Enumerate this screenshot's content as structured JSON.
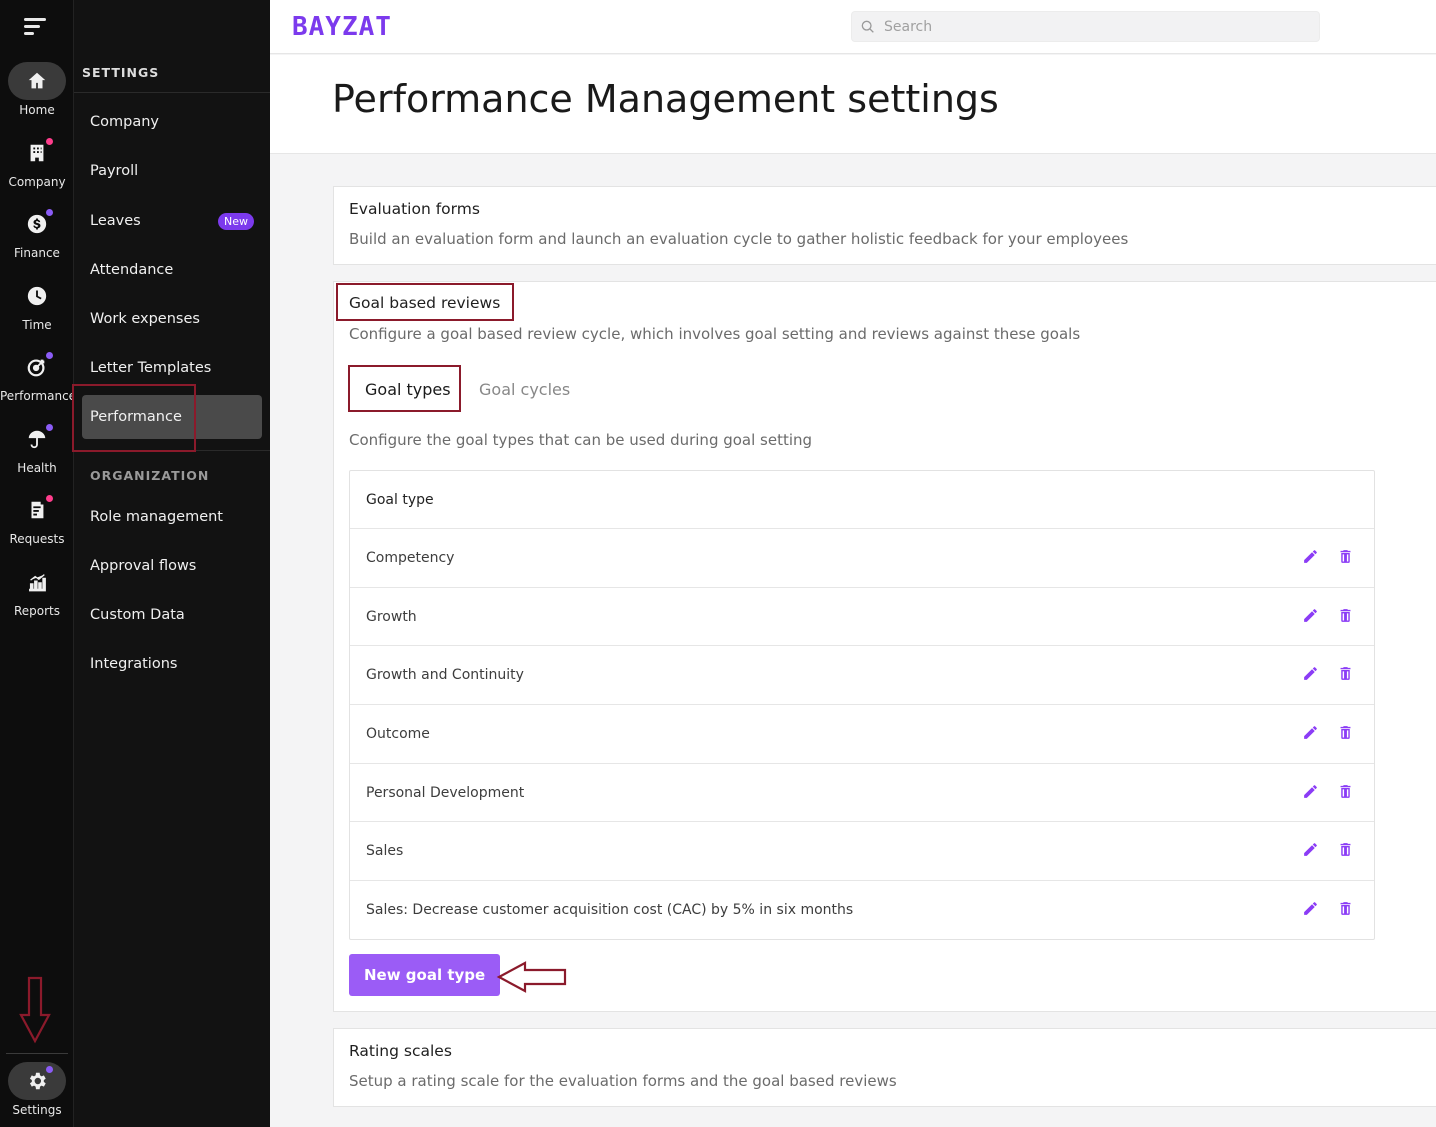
{
  "rail": {
    "items": [
      {
        "label": "Home",
        "icon": "home-icon"
      },
      {
        "label": "Company",
        "icon": "building-icon"
      },
      {
        "label": "Finance",
        "icon": "dollar-icon"
      },
      {
        "label": "Time",
        "icon": "clock-icon"
      },
      {
        "label": "Performance",
        "icon": "target-icon"
      },
      {
        "label": "Health",
        "icon": "umbrella-icon"
      },
      {
        "label": "Requests",
        "icon": "clipboard-icon"
      },
      {
        "label": "Reports",
        "icon": "chart-icon"
      },
      {
        "label": "Settings",
        "icon": "gear-icon"
      }
    ]
  },
  "sidebar": {
    "settings_heading": "SETTINGS",
    "settings_items": [
      "Company",
      "Payroll",
      "Leaves",
      "Attendance",
      "Work expenses",
      "Letter Templates",
      "Performance"
    ],
    "leaves_badge": "New",
    "organization_heading": "ORGANIZATION",
    "organization_items": [
      "Role management",
      "Approval flows",
      "Custom Data",
      "Integrations"
    ]
  },
  "topbar": {
    "logo": "BAYZAT",
    "search_placeholder": "Search"
  },
  "page": {
    "title": "Performance Management settings"
  },
  "evaluation_forms": {
    "title": "Evaluation forms",
    "description": "Build an evaluation form and launch an evaluation cycle to gather holistic feedback for your employees"
  },
  "goal_reviews": {
    "title": "Goal based reviews",
    "description": "Configure a goal based review cycle, which involves goal setting and reviews against these goals",
    "tabs": [
      "Goal types",
      "Goal cycles"
    ],
    "tab_description": "Configure the goal types that can be used during goal setting",
    "table_header": "Goal type",
    "rows": [
      "Competency",
      "Growth",
      "Growth and Continuity",
      "Outcome",
      "Personal Development",
      "Sales",
      "Sales: Decrease customer acquisition cost (CAC) by 5% in six months"
    ],
    "new_button": "New goal type"
  },
  "rating_scales": {
    "title": "Rating scales",
    "description": "Setup a rating scale for the evaluation forms and the goal based reviews"
  },
  "colors": {
    "accent": "#7c3aed",
    "annotation": "#8b1a2b"
  }
}
